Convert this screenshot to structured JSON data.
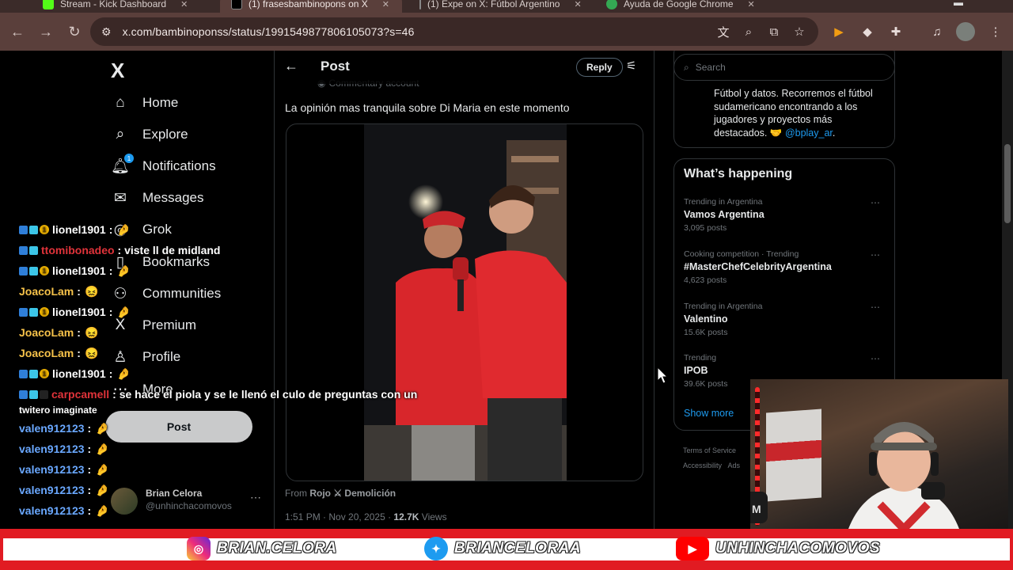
{
  "browser": {
    "tabs": [
      {
        "title": "Stream - Kick Dashboard",
        "favicon_color": "#53fc18"
      },
      {
        "title": "(1) frasesbambinopons on X",
        "favicon_color": "#000000"
      },
      {
        "title": "(1) Expe on X: Fútbol Argentino",
        "favicon_color": "#000000"
      },
      {
        "title": "Ayuda de Google Chrome",
        "favicon_color": "#34a853"
      }
    ],
    "url": "x.com/bambinoponss/status/1991549877806105073?s=46",
    "theme_color": "#5a3f3b"
  },
  "left_nav": {
    "logo": "X",
    "items": [
      {
        "label": "Home",
        "icon": "home-icon",
        "glyph": "⌂"
      },
      {
        "label": "Explore",
        "icon": "search-icon",
        "glyph": "⌕"
      },
      {
        "label": "Notifications",
        "icon": "bell-icon",
        "glyph": "♪",
        "badge": "1"
      },
      {
        "label": "Messages",
        "icon": "envelope-icon",
        "glyph": "✉"
      },
      {
        "label": "Grok",
        "icon": "grok-icon",
        "glyph": "◎"
      },
      {
        "label": "Bookmarks",
        "icon": "bookmark-icon",
        "glyph": "▯"
      },
      {
        "label": "Communities",
        "icon": "communities-icon",
        "glyph": "⚇"
      },
      {
        "label": "Premium",
        "icon": "x-premium-icon",
        "glyph": "X"
      },
      {
        "label": "Profile",
        "icon": "person-icon",
        "glyph": "♙"
      },
      {
        "label": "More",
        "icon": "more-circle-icon",
        "glyph": "⋯"
      }
    ],
    "post_button": "Post",
    "account": {
      "name": "Brian Celora",
      "handle": "@unhinchacomovos"
    }
  },
  "post": {
    "header_title": "Post",
    "reply_button": "Reply",
    "account_note": "Commentary account",
    "text": "La opinión mas tranquila sobre Di Maria en este momento",
    "from_prefix": "From",
    "from_source": "Rojo ⚔ Demolición",
    "timestamp": "1:51 PM · Nov 20, 2025 ·",
    "views_count": "12.7K",
    "views_label": "Views"
  },
  "right_column": {
    "search_placeholder": "Search",
    "bio": {
      "text": "Fútbol y datos. Recorremos el fútbol sudamericano encontrando a los jugadores y proyectos más destacados. 🤝",
      "link": "@bplay_ar",
      "suffix": "."
    },
    "trends_title": "What’s happening",
    "trends": [
      {
        "category": "Trending in Argentina",
        "name": "Vamos Argentina",
        "count": "3,095 posts"
      },
      {
        "category": "Cooking competition · Trending",
        "name": "#MasterChefCelebrityArgentina",
        "count": "4,623 posts"
      },
      {
        "category": "Trending in Argentina",
        "name": "Valentino",
        "count": "15.6K posts"
      },
      {
        "category": "Trending",
        "name": "IPOB",
        "count": "39.6K posts"
      }
    ],
    "show_more": "Show more",
    "footer": [
      "Terms of Service",
      "Accessibility",
      "Ads"
    ]
  },
  "chat": [
    {
      "user": "lionel1901",
      "color": "#ffffff",
      "badges": [
        "sq-blue",
        "sq-cyan",
        "coin"
      ],
      "message": ":",
      "emote": "🤌"
    },
    {
      "user": "ttomibonadeo",
      "color": "#e0333a",
      "badges": [
        "sq-blue",
        "sq-cyan"
      ],
      "message": ": viste ll de midland",
      "emote": ""
    },
    {
      "user": "lionel1901",
      "color": "#ffffff",
      "badges": [
        "sq-blue",
        "sq-cyan",
        "coin"
      ],
      "message": ":",
      "emote": "🤌"
    },
    {
      "user": "JoacoLam",
      "color": "#f6c24a",
      "badges": [],
      "message": ":",
      "emote": "😖"
    },
    {
      "user": "lionel1901",
      "color": "#ffffff",
      "badges": [
        "sq-blue",
        "sq-cyan",
        "coin"
      ],
      "message": ":",
      "emote": "🤌"
    },
    {
      "user": "JoacoLam",
      "color": "#f6c24a",
      "badges": [],
      "message": ":",
      "emote": "😖"
    },
    {
      "user": "JoacoLam",
      "color": "#f6c24a",
      "badges": [],
      "message": ":",
      "emote": "😖"
    },
    {
      "user": "lionel1901",
      "color": "#ffffff",
      "badges": [
        "sq-blue",
        "sq-cyan",
        "coin"
      ],
      "message": ":",
      "emote": "🤌"
    },
    {
      "user": "carpcamell",
      "color": "#e0333a",
      "badges": [
        "sq-blue",
        "sq-cyan",
        "dark"
      ],
      "message": ": se hace el piola y se le llenó el culo de preguntas con un",
      "emote": ""
    },
    {
      "user": "valen912123",
      "color": "#6aa8ff",
      "badges": [],
      "message": ":",
      "emote": "🤌"
    },
    {
      "user": "valen912123",
      "color": "#6aa8ff",
      "badges": [],
      "message": ":",
      "emote": "🤌"
    },
    {
      "user": "valen912123",
      "color": "#6aa8ff",
      "badges": [],
      "message": ":",
      "emote": "🤌"
    },
    {
      "user": "valen912123",
      "color": "#6aa8ff",
      "badges": [],
      "message": ":",
      "emote": "🤌"
    },
    {
      "user": "valen912123",
      "color": "#6aa8ff",
      "badges": [],
      "message": ":",
      "emote": "🤌"
    }
  ],
  "chat_wrap_text": "twitero imaginate",
  "banner": {
    "instagram": "BRIAN.CELORA",
    "twitter": "BRIANCELORAA",
    "youtube": "UNHINCHACOMOVOS",
    "accent_color": "#e11b22"
  },
  "webcam": {
    "corner_label": "M"
  }
}
